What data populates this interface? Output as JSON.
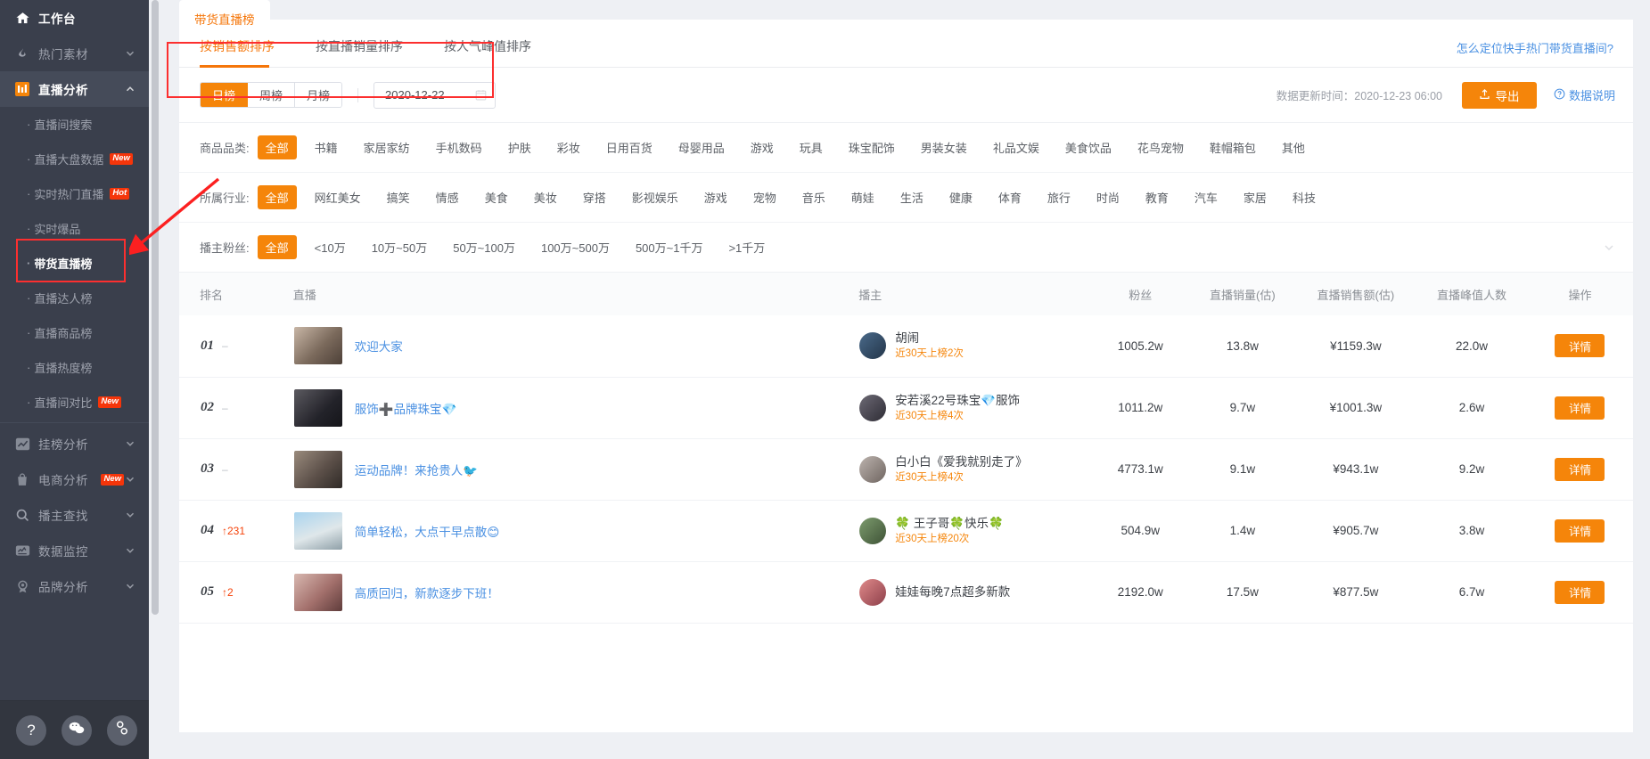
{
  "sidebar": {
    "top_item": {
      "label": "工作台",
      "icon": "home-icon"
    },
    "groups": [
      {
        "label": "热门素材",
        "icon": "fire-icon",
        "expanded": false
      },
      {
        "label": "直播分析",
        "icon": "bar-chart-icon",
        "expanded": true
      }
    ],
    "live_items": [
      {
        "label": "直播间搜索",
        "badge": ""
      },
      {
        "label": "直播大盘数据",
        "badge": "New"
      },
      {
        "label": "实时热门直播",
        "badge": "Hot"
      },
      {
        "label": "实时爆品",
        "badge": ""
      },
      {
        "label": "带货直播榜",
        "badge": "",
        "current": true
      },
      {
        "label": "直播达人榜",
        "badge": ""
      },
      {
        "label": "直播商品榜",
        "badge": ""
      },
      {
        "label": "直播热度榜",
        "badge": ""
      },
      {
        "label": "直播间对比",
        "badge": "New"
      }
    ],
    "bottom_groups": [
      {
        "label": "挂榜分析",
        "icon": "trend-icon",
        "badge": ""
      },
      {
        "label": "电商分析",
        "icon": "bag-icon",
        "badge": "New"
      },
      {
        "label": "播主查找",
        "icon": "search-icon",
        "badge": ""
      },
      {
        "label": "数据监控",
        "icon": "monitor-icon",
        "badge": ""
      },
      {
        "label": "品牌分析",
        "icon": "medal-icon",
        "badge": ""
      }
    ],
    "footer_buttons": [
      {
        "name": "help-button",
        "glyph": "?"
      },
      {
        "name": "wechat-button",
        "glyph": "✆"
      },
      {
        "name": "link-button",
        "glyph": "⚭"
      }
    ]
  },
  "page": {
    "tab_label": "带货直播榜",
    "sort_tabs": [
      {
        "label": "按销售额排序",
        "active": true
      },
      {
        "label": "按直播销量排序",
        "active": false
      },
      {
        "label": "按人气峰值排序",
        "active": false
      }
    ],
    "help_link": "怎么定位快手热门带货直播间?"
  },
  "toolbar": {
    "period_options": [
      {
        "label": "日榜",
        "active": true
      },
      {
        "label": "周榜",
        "active": false
      },
      {
        "label": "月榜",
        "active": false
      }
    ],
    "date_value": "2020-12-22",
    "update_time": "数据更新时间：2020-12-23 06:00",
    "export_label": "导出",
    "data_note_label": "数据说明"
  },
  "filters": [
    {
      "label": "商品品类:",
      "options": [
        "全部",
        "书籍",
        "家居家纺",
        "手机数码",
        "护肤",
        "彩妆",
        "日用百货",
        "母婴用品",
        "游戏",
        "玩具",
        "珠宝配饰",
        "男装女装",
        "礼品文娱",
        "美食饮品",
        "花鸟宠物",
        "鞋帽箱包",
        "其他"
      ],
      "selected": "全部"
    },
    {
      "label": "所属行业:",
      "options": [
        "全部",
        "网红美女",
        "搞笑",
        "情感",
        "美食",
        "美妆",
        "穿搭",
        "影视娱乐",
        "游戏",
        "宠物",
        "音乐",
        "萌娃",
        "生活",
        "健康",
        "体育",
        "旅行",
        "时尚",
        "教育",
        "汽车",
        "家居",
        "科技"
      ],
      "selected": "全部"
    },
    {
      "label": "播主粉丝:",
      "options": [
        "全部",
        "<10万",
        "10万~50万",
        "50万~100万",
        "100万~500万",
        "500万~1千万",
        ">1千万"
      ],
      "selected": "全部"
    }
  ],
  "table": {
    "headers": [
      "排名",
      "直播",
      "播主",
      "粉丝",
      "直播销量(估)",
      "直播销售额(估)",
      "直播峰值人数",
      "操作"
    ],
    "action_label": "详情",
    "rows": [
      {
        "rank": "01",
        "trend": "–",
        "trend_dir": "flat",
        "live_title": "欢迎大家",
        "host_name": "胡闹",
        "host_tag": "近30天上榜2次",
        "fans": "1005.2w",
        "sales": "13.8w",
        "amount": "¥1159.3w",
        "peak": "22.0w"
      },
      {
        "rank": "02",
        "trend": "–",
        "trend_dir": "flat",
        "live_title": "服饰➕品牌珠宝💎",
        "host_name": "安若溪22号珠宝💎服饰",
        "host_tag": "近30天上榜4次",
        "fans": "1011.2w",
        "sales": "9.7w",
        "amount": "¥1001.3w",
        "peak": "2.6w"
      },
      {
        "rank": "03",
        "trend": "–",
        "trend_dir": "flat",
        "live_title": "运动品牌！来抢贵人🐦",
        "host_name": "白小白《爱我就别走了》",
        "host_tag": "近30天上榜4次",
        "fans": "4773.1w",
        "sales": "9.1w",
        "amount": "¥943.1w",
        "peak": "9.2w"
      },
      {
        "rank": "04",
        "trend": "↑231",
        "trend_dir": "up",
        "live_title": "简单轻松，大点干早点散😊",
        "host_name": "🍀 王子哥🍀快乐🍀",
        "host_tag": "近30天上榜20次",
        "fans": "504.9w",
        "sales": "1.4w",
        "amount": "¥905.7w",
        "peak": "3.8w"
      },
      {
        "rank": "05",
        "trend": "↑2",
        "trend_dir": "up",
        "live_title": "高质回归，新款逐步下班！",
        "host_name": "娃娃每晚7点超多新款",
        "host_tag": "",
        "fans": "2192.0w",
        "sales": "17.5w",
        "amount": "¥877.5w",
        "peak": "6.7w"
      }
    ]
  },
  "colors": {
    "accent": "#f5850a",
    "link": "#4a90e2",
    "highlight": "#fc2f2f",
    "sidebar_bg": "#3a3f4c"
  }
}
